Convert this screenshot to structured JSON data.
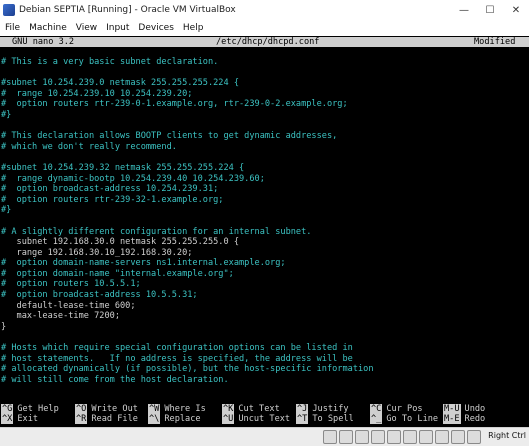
{
  "window": {
    "title": "Debian SEPTIA [Running] - Oracle VM VirtualBox",
    "controls": [
      "—",
      "☐",
      "✕"
    ]
  },
  "menu": [
    "File",
    "Machine",
    "View",
    "Input",
    "Devices",
    "Help"
  ],
  "nano": {
    "version": "GNU nano 3.2",
    "filename": "/etc/dhcp/dhcpd.conf",
    "status": "Modified"
  },
  "lines": [
    {
      "text": "# This is a very basic subnet declaration.",
      "kind": "c"
    },
    {
      "text": "",
      "kind": "t"
    },
    {
      "text": "#subnet 10.254.239.0 netmask 255.255.255.224 {",
      "kind": "c"
    },
    {
      "text": "#  range 10.254.239.10 10.254.239.20;",
      "kind": "c"
    },
    {
      "text": "#  option routers rtr-239-0-1.example.org, rtr-239-0-2.example.org;",
      "kind": "c"
    },
    {
      "text": "#}",
      "kind": "c"
    },
    {
      "text": "",
      "kind": "t"
    },
    {
      "text": "# This declaration allows BOOTP clients to get dynamic addresses,",
      "kind": "c"
    },
    {
      "text": "# which we don't really recommend.",
      "kind": "c"
    },
    {
      "text": "",
      "kind": "t"
    },
    {
      "text": "#subnet 10.254.239.32 netmask 255.255.255.224 {",
      "kind": "c"
    },
    {
      "text": "#  range dynamic-bootp 10.254.239.40 10.254.239.60;",
      "kind": "c"
    },
    {
      "text": "#  option broadcast-address 10.254.239.31;",
      "kind": "c"
    },
    {
      "text": "#  option routers rtr-239-32-1.example.org;",
      "kind": "c"
    },
    {
      "text": "#}",
      "kind": "c"
    },
    {
      "text": "",
      "kind": "t"
    },
    {
      "text": "# A slightly different configuration for an internal subnet.",
      "kind": "c"
    },
    {
      "text": "   subnet 192.168.30.0 netmask 255.255.255.0 {",
      "kind": "t"
    },
    {
      "text": "   range 192.168.30.10_192.168.30.20;",
      "kind": "t"
    },
    {
      "text": "#  option domain-name-servers ns1.internal.example.org;",
      "kind": "c"
    },
    {
      "text": "#  option domain-name \"internal.example.org\";",
      "kind": "c"
    },
    {
      "text": "#  option routers 10.5.5.1;",
      "kind": "c"
    },
    {
      "text": "#  option broadcast-address 10.5.5.31;",
      "kind": "c"
    },
    {
      "text": "   default-lease-time 600;",
      "kind": "t"
    },
    {
      "text": "   max-lease-time 7200;",
      "kind": "t"
    },
    {
      "text": "}",
      "kind": "t"
    },
    {
      "text": "",
      "kind": "t"
    },
    {
      "text": "# Hosts which require special configuration options can be listed in",
      "kind": "c"
    },
    {
      "text": "# host statements.   If no address is specified, the address will be",
      "kind": "c"
    },
    {
      "text": "# allocated dynamically (if possible), but the host-specific information",
      "kind": "c"
    },
    {
      "text": "# will still come from the host declaration.",
      "kind": "c"
    }
  ],
  "shortcuts_row1": [
    {
      "key": "^G",
      "label": "Get Help"
    },
    {
      "key": "^O",
      "label": "Write Out"
    },
    {
      "key": "^W",
      "label": "Where Is"
    },
    {
      "key": "^K",
      "label": "Cut Text"
    },
    {
      "key": "^J",
      "label": "Justify"
    },
    {
      "key": "^C",
      "label": "Cur Pos"
    },
    {
      "key": "M-U",
      "label": "Undo"
    }
  ],
  "shortcuts_row2": [
    {
      "key": "^X",
      "label": "Exit"
    },
    {
      "key": "^R",
      "label": "Read File"
    },
    {
      "key": "^\\",
      "label": "Replace"
    },
    {
      "key": "^U",
      "label": "Uncut Text"
    },
    {
      "key": "^T",
      "label": "To Spell"
    },
    {
      "key": "^_",
      "label": "Go To Line"
    },
    {
      "key": "M-E",
      "label": "Redo"
    }
  ],
  "statusbar": {
    "host_key": "Right Ctrl"
  },
  "colors": {
    "comment": "#3cc3c3",
    "text": "#d0d0d0",
    "terminal_bg": "#000000",
    "header_bg": "#cfcfcf"
  }
}
